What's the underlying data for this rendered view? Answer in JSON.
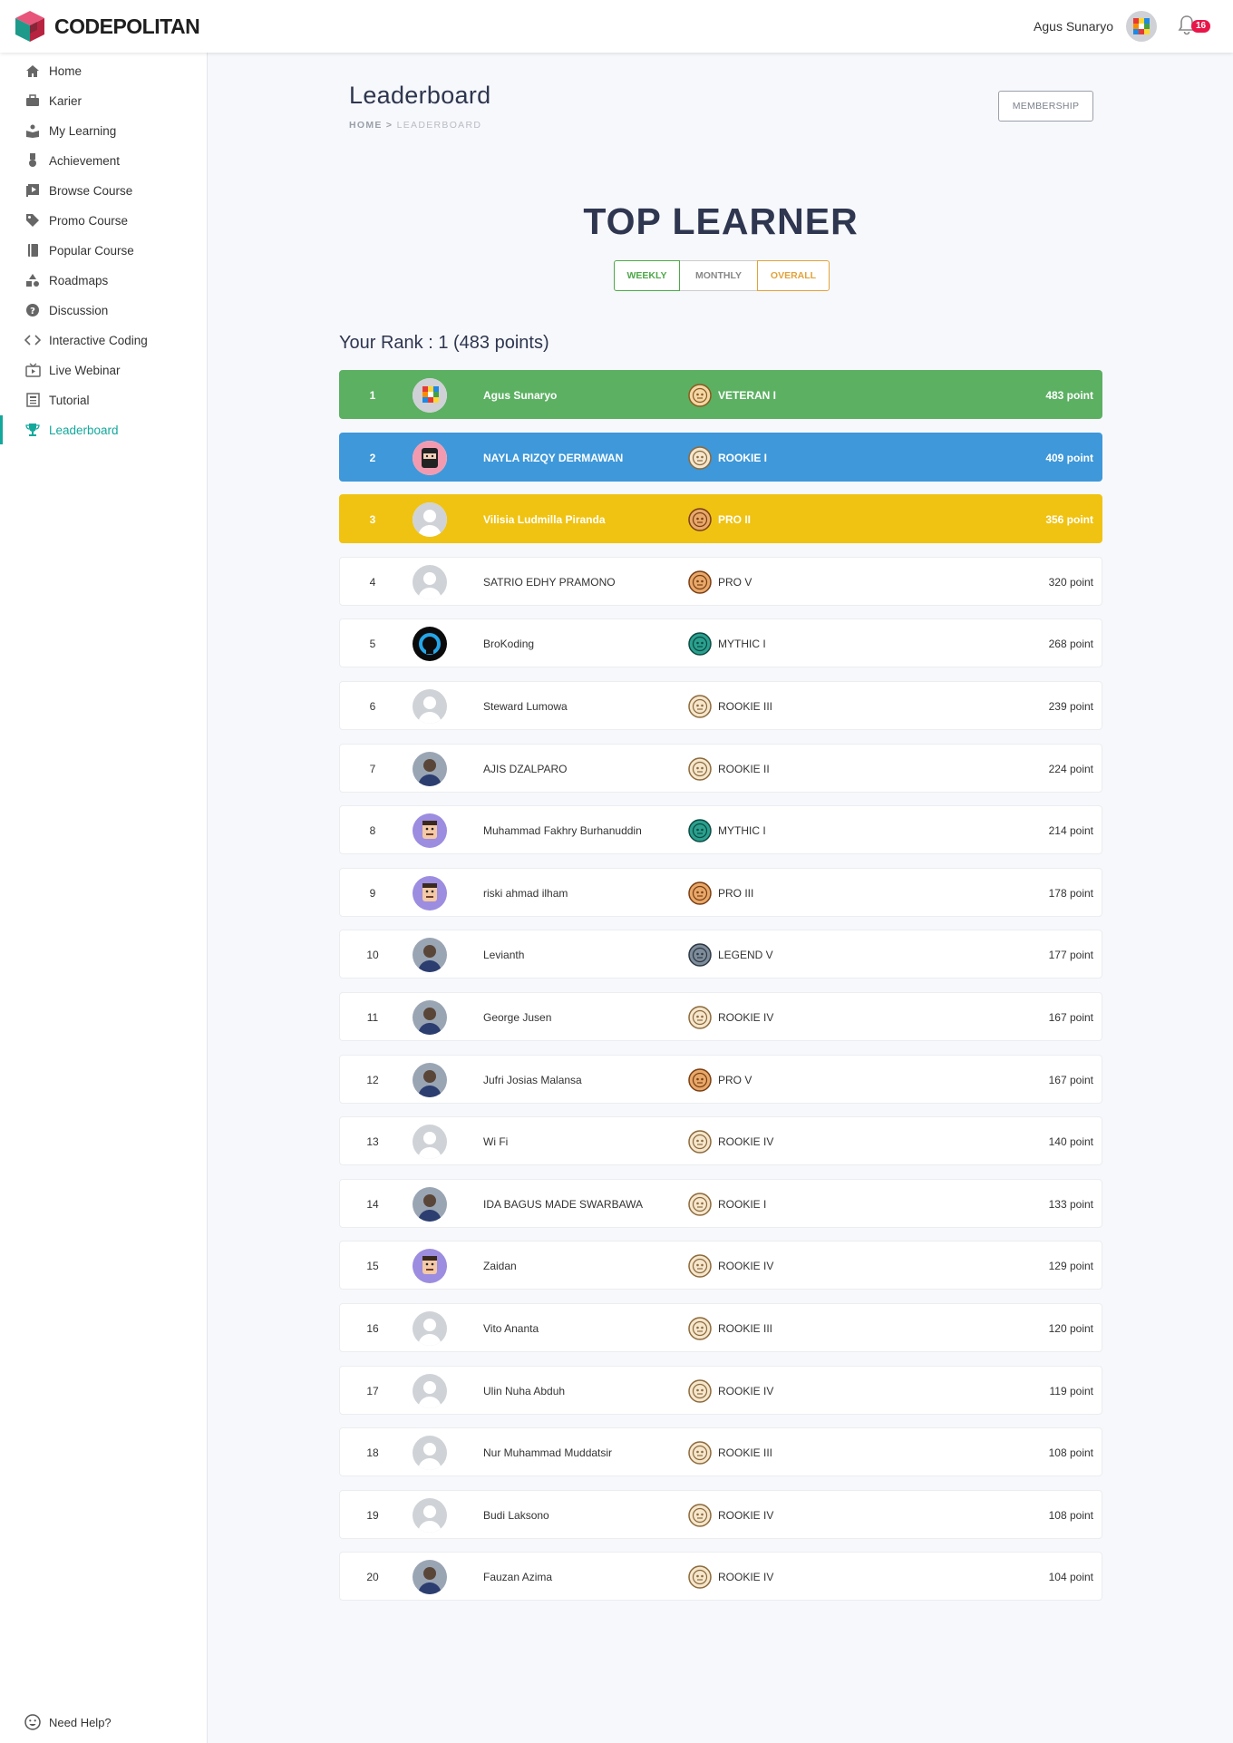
{
  "brand": {
    "logo_bold": "CODE",
    "logo_rest": "POLITAN"
  },
  "user": {
    "name": "Agus Sunaryo",
    "notifications": "16"
  },
  "sidebar": {
    "items": [
      {
        "label": "Home",
        "icon": "home-icon"
      },
      {
        "label": "Karier",
        "icon": "briefcase-icon"
      },
      {
        "label": "My Learning",
        "icon": "book-reader-icon"
      },
      {
        "label": "Achievement",
        "icon": "medal-icon"
      },
      {
        "label": "Browse Course",
        "icon": "play-library-icon"
      },
      {
        "label": "Promo Course",
        "icon": "tag-icon"
      },
      {
        "label": "Popular Course",
        "icon": "book-icon"
      },
      {
        "label": "Roadmaps",
        "icon": "shapes-icon"
      },
      {
        "label": "Discussion",
        "icon": "question-circle-icon"
      },
      {
        "label": "Interactive Coding",
        "icon": "code-icon"
      },
      {
        "label": "Live Webinar",
        "icon": "tv-icon"
      },
      {
        "label": "Tutorial",
        "icon": "newspaper-icon"
      },
      {
        "label": "Leaderboard",
        "icon": "trophy-icon",
        "active": true
      }
    ],
    "help": "Need Help?"
  },
  "header": {
    "title": "Leaderboard",
    "breadcrumb_home": "HOME",
    "breadcrumb_sep": ">",
    "breadcrumb_current": "LEADERBOARD",
    "membership": "MEMBERSHIP"
  },
  "board": {
    "heading": "TOP LEARNER",
    "tabs": [
      "WEEKLY",
      "MONTHLY",
      "OVERALL"
    ],
    "your_rank": "Your Rank : 1 (483 points)",
    "rows": [
      {
        "rank": "1",
        "name": "Agus Sunaryo",
        "level": "VETERAN I",
        "points": "483 point",
        "avatar": "rubik-avatar",
        "badge": "veteran"
      },
      {
        "rank": "2",
        "name": "NAYLA RIZQY DERMAWAN",
        "level": "ROOKIE I",
        "points": "409 point",
        "avatar": "ninja-avatar",
        "badge": "rookie"
      },
      {
        "rank": "3",
        "name": "Vilisia Ludmilla Piranda",
        "level": "PRO II",
        "points": "356 point",
        "avatar": "default-avatar",
        "badge": "pro"
      },
      {
        "rank": "4",
        "name": "SATRIO EDHY PRAMONO",
        "level": "PRO V",
        "points": "320 point",
        "avatar": "default-avatar",
        "badge": "pro"
      },
      {
        "rank": "5",
        "name": "BroKoding",
        "level": "MYTHIC I",
        "points": "268 point",
        "avatar": "brokoding-avatar",
        "badge": "mythic"
      },
      {
        "rank": "6",
        "name": "Steward Lumowa",
        "level": "ROOKIE III",
        "points": "239 point",
        "avatar": "default-avatar",
        "badge": "rookie"
      },
      {
        "rank": "7",
        "name": "AJIS DZALPARO",
        "level": "ROOKIE II",
        "points": "224 point",
        "avatar": "photo-avatar",
        "badge": "rookie"
      },
      {
        "rank": "8",
        "name": "Muhammad Fakhry Burhanuddin",
        "level": "MYTHIC I",
        "points": "214 point",
        "avatar": "character-avatar",
        "badge": "mythic"
      },
      {
        "rank": "9",
        "name": "riski ahmad ilham",
        "level": "PRO III",
        "points": "178 point",
        "avatar": "character-avatar",
        "badge": "pro"
      },
      {
        "rank": "10",
        "name": "Levianth",
        "level": "LEGEND V",
        "points": "177 point",
        "avatar": "photo-avatar",
        "badge": "legend"
      },
      {
        "rank": "11",
        "name": "George Jusen",
        "level": "ROOKIE IV",
        "points": "167 point",
        "avatar": "photo-avatar",
        "badge": "rookie"
      },
      {
        "rank": "12",
        "name": "Jufri Josias Malansa",
        "level": "PRO V",
        "points": "167 point",
        "avatar": "photo-avatar",
        "badge": "pro"
      },
      {
        "rank": "13",
        "name": "Wi Fi",
        "level": "ROOKIE IV",
        "points": "140 point",
        "avatar": "default-avatar",
        "badge": "rookie"
      },
      {
        "rank": "14",
        "name": "IDA BAGUS MADE SWARBAWA",
        "level": "ROOKIE I",
        "points": "133 point",
        "avatar": "photo-avatar",
        "badge": "rookie"
      },
      {
        "rank": "15",
        "name": "Zaidan",
        "level": "ROOKIE IV",
        "points": "129 point",
        "avatar": "character-avatar",
        "badge": "rookie"
      },
      {
        "rank": "16",
        "name": "Vito Ananta",
        "level": "ROOKIE III",
        "points": "120 point",
        "avatar": "default-avatar",
        "badge": "rookie"
      },
      {
        "rank": "17",
        "name": "Ulin Nuha Abduh",
        "level": "ROOKIE IV",
        "points": "119 point",
        "avatar": "default-avatar",
        "badge": "rookie"
      },
      {
        "rank": "18",
        "name": "Nur Muhammad Muddatsir",
        "level": "ROOKIE III",
        "points": "108 point",
        "avatar": "default-avatar",
        "badge": "rookie"
      },
      {
        "rank": "19",
        "name": "Budi Laksono",
        "level": "ROOKIE IV",
        "points": "108 point",
        "avatar": "default-avatar",
        "badge": "rookie"
      },
      {
        "rank": "20",
        "name": "Fauzan Azima",
        "level": "ROOKIE IV",
        "points": "104 point",
        "avatar": "photo-avatar",
        "badge": "rookie"
      }
    ]
  },
  "colors": {
    "accent": "#14a89c",
    "rank1": "#5cb062",
    "rank2": "#3e98d9",
    "rank3": "#f0c312",
    "weekly": "#4fa84a",
    "overall": "#e2a23a",
    "notification": "#e8174a"
  }
}
